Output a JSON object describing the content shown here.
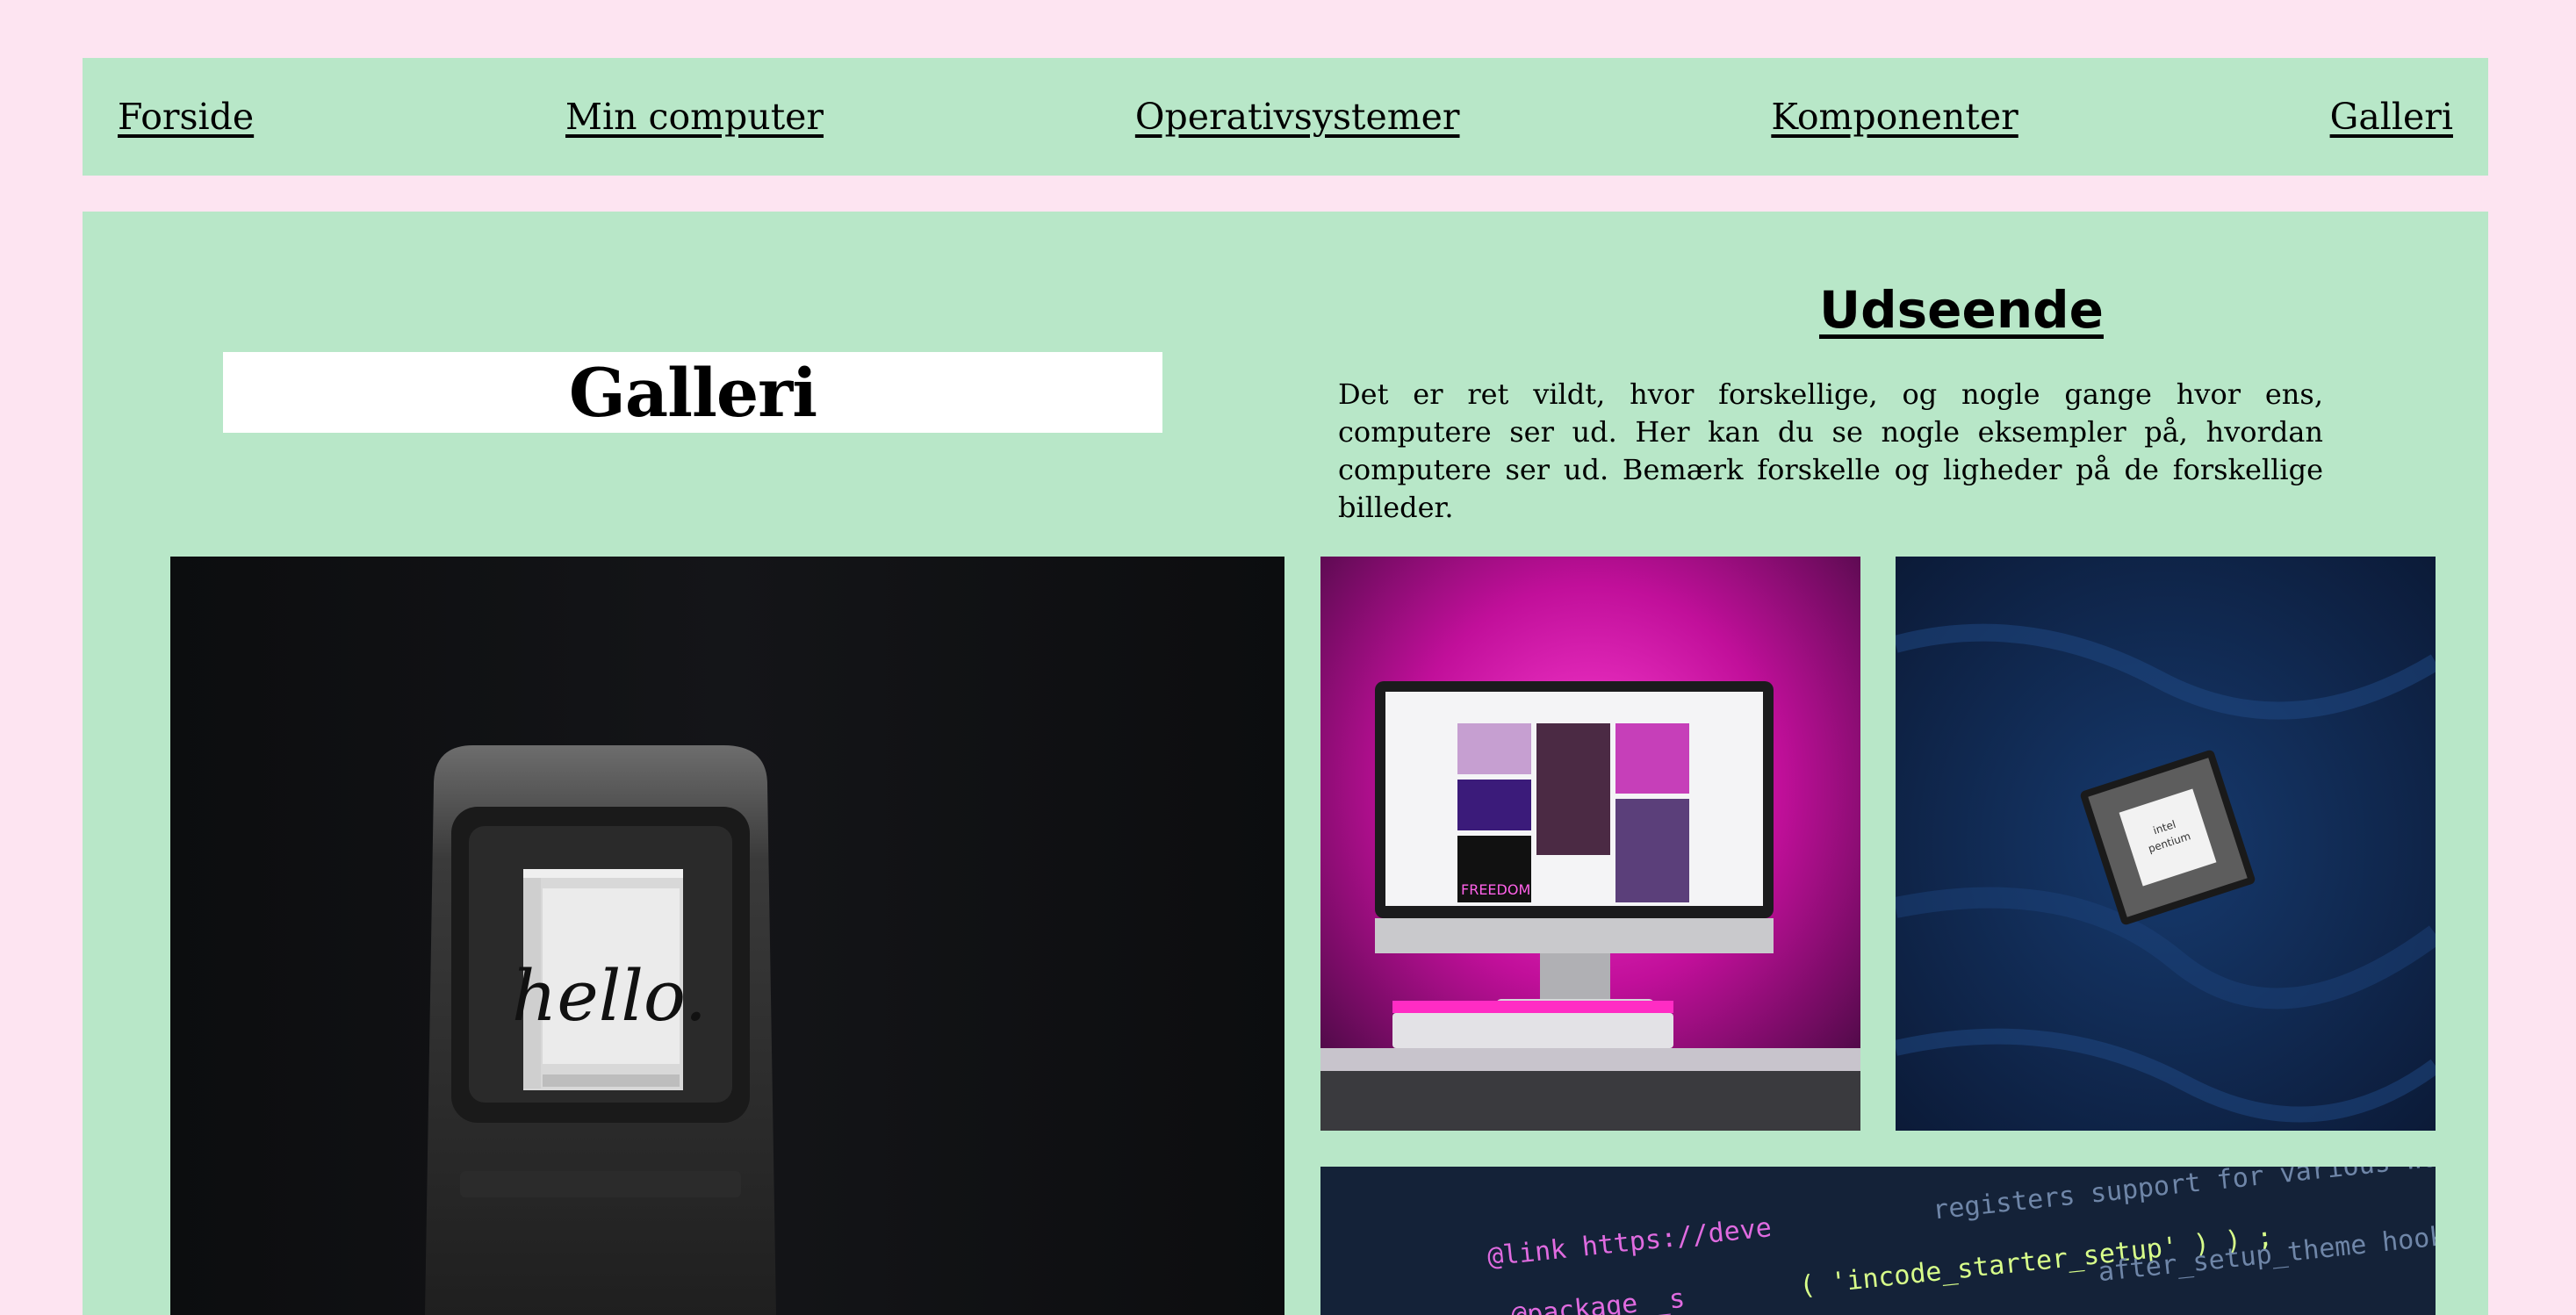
{
  "nav": {
    "items": [
      {
        "label": "Forside"
      },
      {
        "label": "Min computer"
      },
      {
        "label": "Operativsystemer"
      },
      {
        "label": "Komponenter"
      },
      {
        "label": "Galleri"
      }
    ]
  },
  "page_title": "Galleri",
  "section": {
    "heading": "Udseende",
    "text": "Det er ret vildt, hvor forskellige, og nogle gange hvor ens, computere ser ud. Her kan du se nogle eksempler på, hvordan computere ser ud. Bemærk forskelle og ligheder på de forskellige billeder."
  },
  "gallery": {
    "hello_screen_text": "hello.",
    "cpu_label_line1": "intel",
    "cpu_label_line2": "pentium",
    "code_line1": "@link https://deve",
    "code_line2": "@package _s",
    "code_line3": "( 'incode_starter_setup' ) ) ;",
    "code_line4": "registers support for various WordPress fe",
    "code_line5": "after_setup_theme hook, which",
    "pink_screen_text": "FREEDOM"
  }
}
